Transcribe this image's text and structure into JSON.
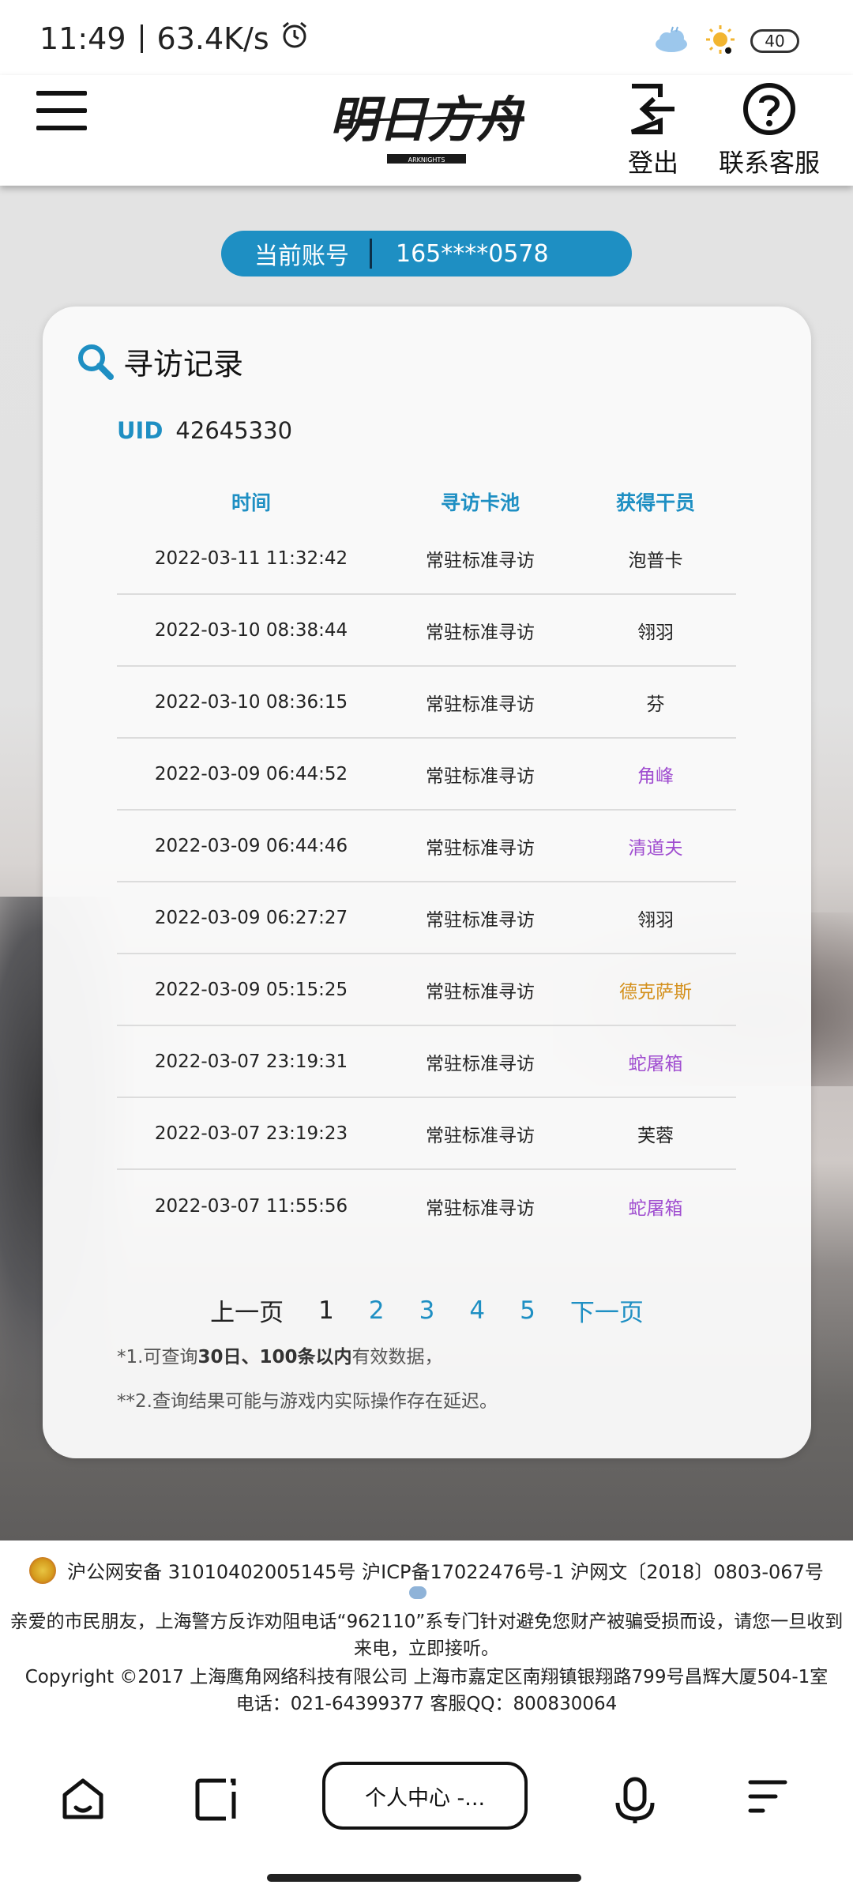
{
  "status_bar": {
    "time": "11:49",
    "speed": "63.4K/s",
    "battery": "40"
  },
  "header": {
    "logo_text": "明日方舟",
    "logo_sub": "ARKNIGHTS",
    "logout_label": "登出",
    "contact_label": "联系客服"
  },
  "account": {
    "label": "当前账号",
    "value": "165****0578"
  },
  "card": {
    "title": "寻访记录",
    "uid_label": "UID",
    "uid_value": "42645330",
    "columns": [
      "时间",
      "寻访卡池",
      "获得干员"
    ],
    "rows": [
      {
        "time": "2022-03-11 11:32:42",
        "pool": "常驻标准寻访",
        "operator": "泡普卡",
        "color": "#222222"
      },
      {
        "time": "2022-03-10 08:38:44",
        "pool": "常驻标准寻访",
        "operator": "翎羽",
        "color": "#222222"
      },
      {
        "time": "2022-03-10 08:36:15",
        "pool": "常驻标准寻访",
        "operator": "芬",
        "color": "#222222"
      },
      {
        "time": "2022-03-09 06:44:52",
        "pool": "常驻标准寻访",
        "operator": "角峰",
        "color": "#a04ed0"
      },
      {
        "time": "2022-03-09 06:44:46",
        "pool": "常驻标准寻访",
        "operator": "清道夫",
        "color": "#a04ed0"
      },
      {
        "time": "2022-03-09 06:27:27",
        "pool": "常驻标准寻访",
        "operator": "翎羽",
        "color": "#222222"
      },
      {
        "time": "2022-03-09 05:15:25",
        "pool": "常驻标准寻访",
        "operator": "德克萨斯",
        "color": "#d4901c"
      },
      {
        "time": "2022-03-07 23:19:31",
        "pool": "常驻标准寻访",
        "operator": "蛇屠箱",
        "color": "#a04ed0"
      },
      {
        "time": "2022-03-07 23:19:23",
        "pool": "常驻标准寻访",
        "operator": "芙蓉",
        "color": "#222222"
      },
      {
        "time": "2022-03-07 11:55:56",
        "pool": "常驻标准寻访",
        "operator": "蛇屠箱",
        "color": "#a04ed0"
      }
    ],
    "pager": {
      "prev": "上一页",
      "pages": [
        "1",
        "2",
        "3",
        "4",
        "5"
      ],
      "current": "1",
      "next": "下一页"
    },
    "note1_prefix": "*1.可查询",
    "note1_bold": "30日、100条以内",
    "note1_suffix": "有效数据，",
    "note2": "**2.查询结果可能与游戏内实际操作存在延迟。"
  },
  "footer": {
    "line1": "沪公网安备 31010402005145号  沪ICP备17022476号-1  沪网文〔2018〕0803-067号",
    "line2": "亲爱的市民朋友，上海警方反诈劝阻电话“962110”系专门针对避免您财产被骗受损而设，请您一旦收到来电，立即接听。",
    "line3a": "Copyright ©2017 上海鹰角网络科技有限公司  上海市嘉定区南翔镇银翔路799号昌辉大厦504-1室",
    "line3b": "电话：021-64399377 客服QQ：800830064"
  },
  "toolbar": {
    "address": "个人中心 -..."
  }
}
